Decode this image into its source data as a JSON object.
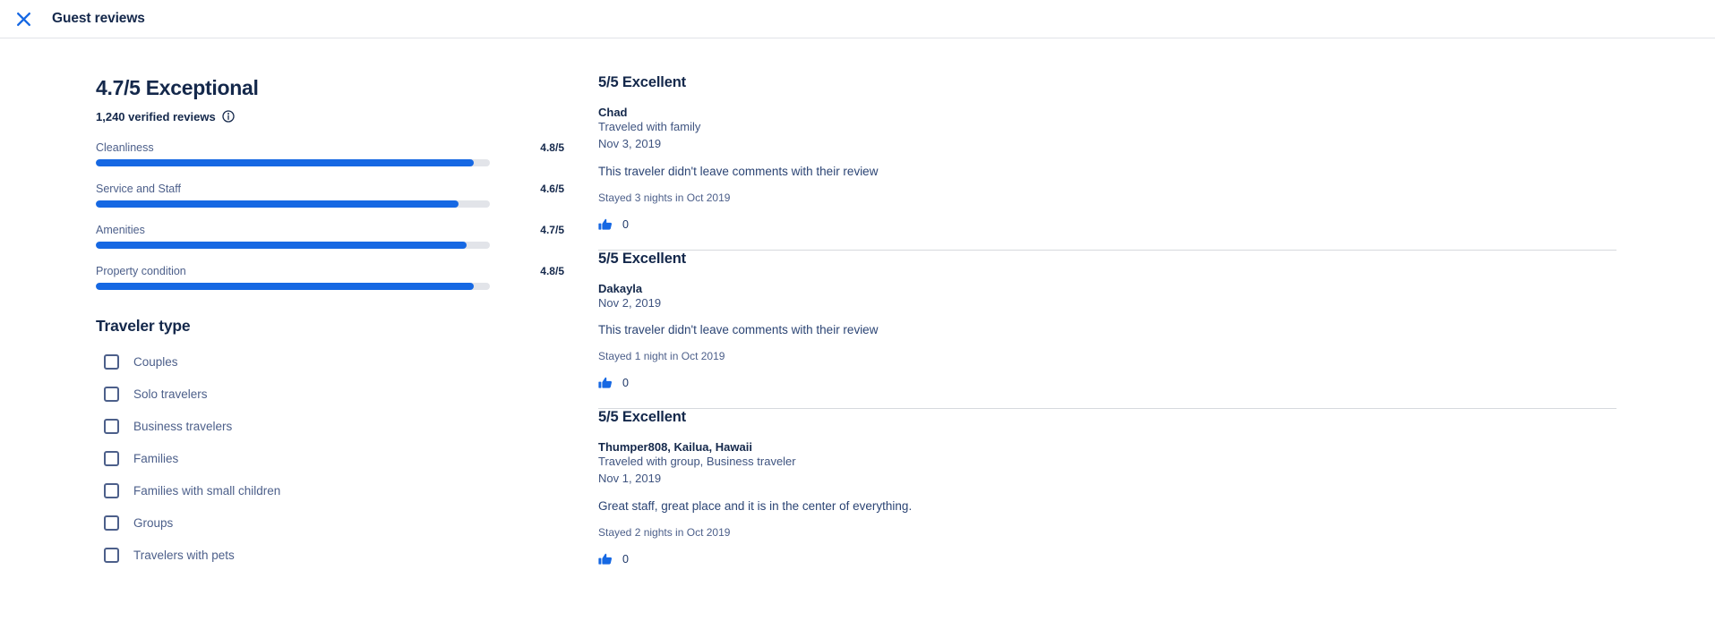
{
  "header": {
    "close_icon": "close-icon",
    "title": "Guest reviews"
  },
  "summary": {
    "score_heading": "4.7/5 Exceptional",
    "verified_reviews": "1,240 verified reviews",
    "info_icon": "info-icon"
  },
  "category_ratings": [
    {
      "label": "Cleanliness",
      "value": "4.8/5",
      "percent": 96
    },
    {
      "label": "Service and Staff",
      "value": "4.6/5",
      "percent": 92
    },
    {
      "label": "Amenities",
      "value": "4.7/5",
      "percent": 94
    },
    {
      "label": "Property condition",
      "value": "4.8/5",
      "percent": 96
    }
  ],
  "traveler_type": {
    "title": "Traveler type",
    "options": [
      {
        "label": "Couples",
        "checked": false
      },
      {
        "label": "Solo travelers",
        "checked": false
      },
      {
        "label": "Business travelers",
        "checked": false
      },
      {
        "label": "Families",
        "checked": false
      },
      {
        "label": "Families with small children",
        "checked": false
      },
      {
        "label": "Groups",
        "checked": false
      },
      {
        "label": "Travelers with pets",
        "checked": false
      }
    ]
  },
  "reviews": [
    {
      "score": "5/5 Excellent",
      "reviewer": "Chad",
      "traveled_with": "Traveled with family",
      "date": "Nov 3, 2019",
      "text": "This traveler didn't leave comments with their review",
      "stayed": "Stayed 3 nights in Oct 2019",
      "helpful_icon": "thumbs-up-icon",
      "helpful_count": "0"
    },
    {
      "score": "5/5 Excellent",
      "reviewer": "Dakayla",
      "traveled_with": "",
      "date": "Nov 2, 2019",
      "text": "This traveler didn't leave comments with their review",
      "stayed": "Stayed 1 night in Oct 2019",
      "helpful_icon": "thumbs-up-icon",
      "helpful_count": "0"
    },
    {
      "score": "5/5 Excellent",
      "reviewer": "Thumper808, Kailua, Hawaii",
      "traveled_with": "Traveled with group, Business traveler",
      "date": "Nov 1, 2019",
      "text": "Great staff, great place and it is in the center of everything.",
      "stayed": "Stayed 2 nights in Oct 2019",
      "helpful_icon": "thumbs-up-icon",
      "helpful_count": "0"
    }
  ],
  "colors": {
    "accent_blue": "#1668e3",
    "navy": "#14284b",
    "muted": "#4c5f8a",
    "track": "#e2e4e9"
  }
}
